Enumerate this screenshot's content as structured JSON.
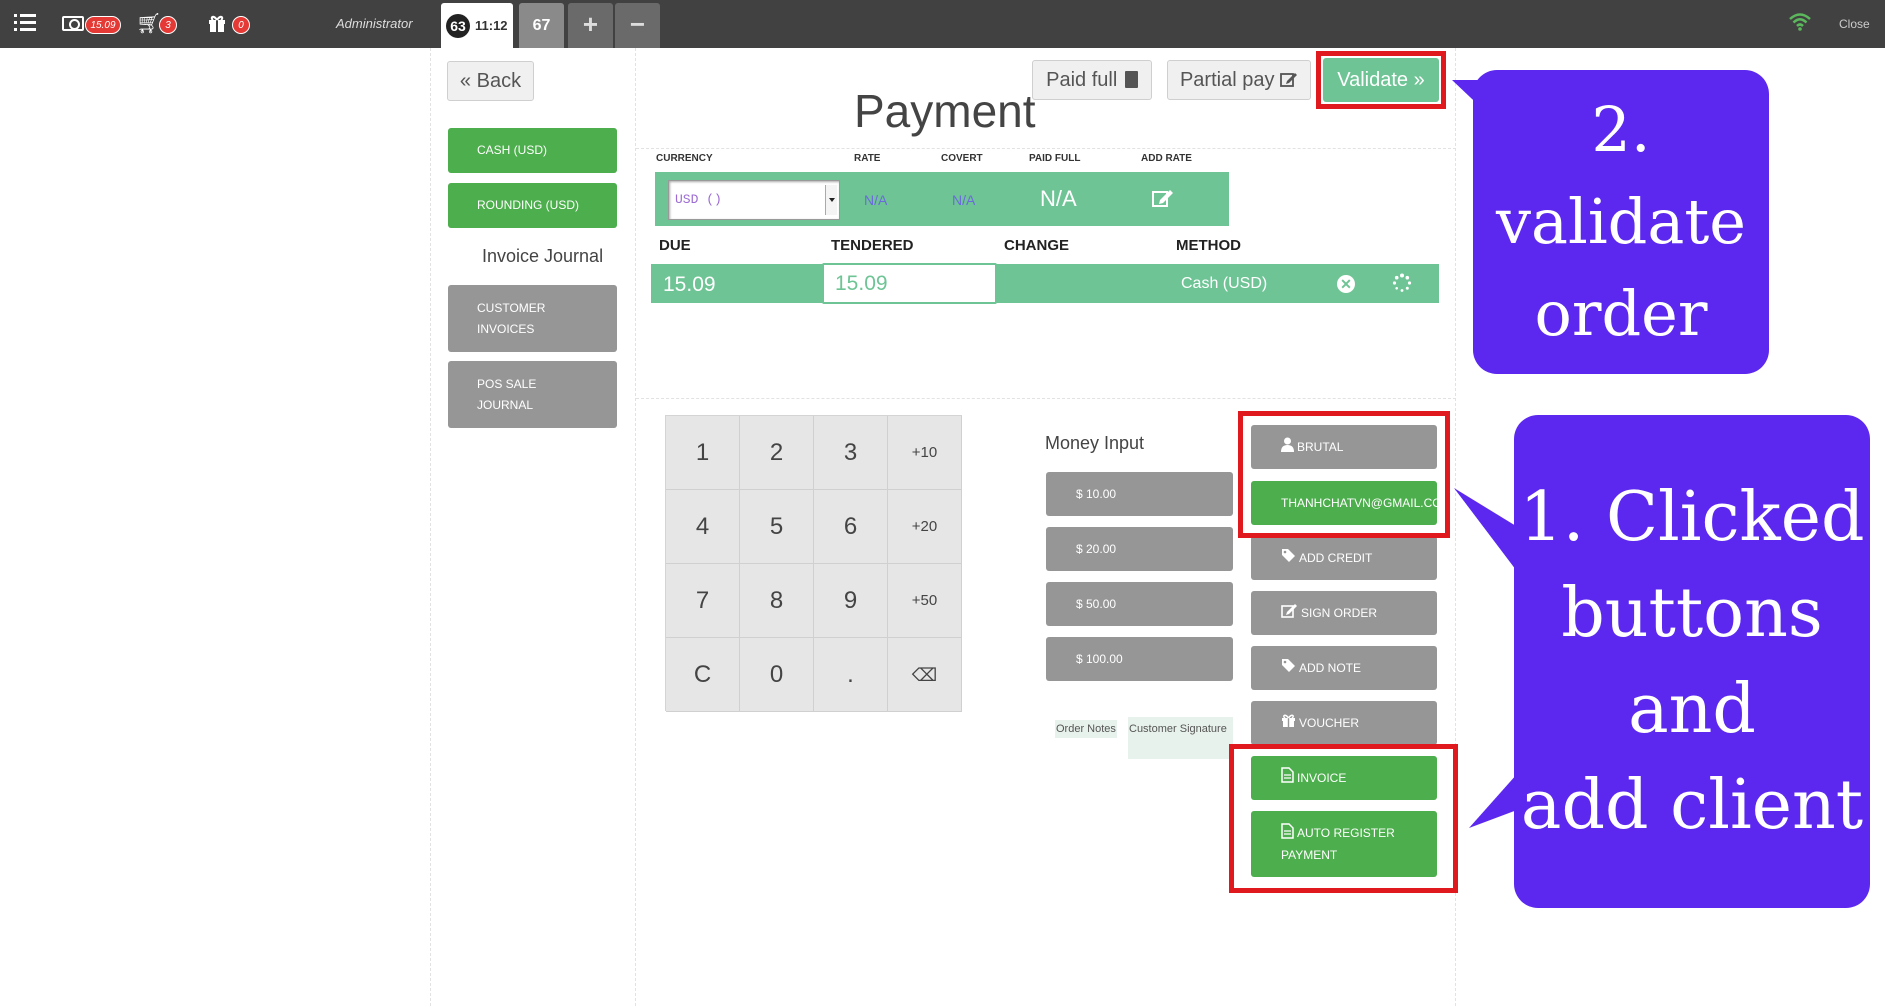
{
  "topbar": {
    "cash_badge": "15.09",
    "cart_badge": "3",
    "gift_badge": "0",
    "user": "Administrator",
    "active_order_number": "63",
    "active_order_time": "11:12",
    "other_order": "67",
    "add_order": "+",
    "remove_order": "−",
    "close_label": "Close"
  },
  "header": {
    "back_label": "« Back",
    "title": "Payment",
    "paid_full_label": "Paid full",
    "partial_pay_label": "Partial pay",
    "validate_label": "Validate »"
  },
  "sidebar": {
    "methods": [
      {
        "label": "CASH (USD)"
      },
      {
        "label": "ROUNDING (USD)"
      }
    ],
    "journal_title": "Invoice Journal",
    "journals": [
      {
        "label": "CUSTOMER INVOICES"
      },
      {
        "label": "POS SALE JOURNAL"
      }
    ]
  },
  "currency": {
    "headers": {
      "currency": "CURRENCY",
      "rate": "RATE",
      "covert": "COVERT",
      "paid_full": "PAID FULL",
      "add_rate": "ADD RATE"
    },
    "selected": "USD ()",
    "rate": "N/A",
    "covert": "N/A",
    "paid_full": "N/A"
  },
  "paymentlines": {
    "headers": {
      "due": "DUE",
      "tendered": "TENDERED",
      "change": "CHANGE",
      "method": "METHOD"
    },
    "line": {
      "due": "15.09",
      "tendered": "15.09",
      "change": "",
      "method": "Cash (USD)"
    }
  },
  "numpad": {
    "keys": [
      "1",
      "2",
      "3",
      "+10",
      "4",
      "5",
      "6",
      "+20",
      "7",
      "8",
      "9",
      "+50",
      "C",
      "0",
      ".",
      "⌫"
    ]
  },
  "money_input": {
    "title": "Money Input",
    "amounts": [
      "$ 10.00",
      "$ 20.00",
      "$ 50.00",
      "$ 100.00"
    ],
    "order_notes": "Order Notes",
    "customer_signature": "Customer Signature"
  },
  "actions": {
    "client": "BRUTAL",
    "email": "THANHCHATVN@GMAIL.COM",
    "add_credit": "ADD CREDIT",
    "sign_order": "SIGN ORDER",
    "add_note": "ADD NOTE",
    "voucher": "VOUCHER",
    "invoice": "INVOICE",
    "auto_register": "AUTO REGISTER PAYMENT"
  },
  "annotations": {
    "bubble1": [
      "1. Clicked",
      "buttons and",
      "add client"
    ],
    "bubble2": [
      "2.",
      "validate",
      "order"
    ]
  },
  "colors": {
    "topbar": "#414141",
    "green": "#4cae4c",
    "teal": "#6ec495",
    "gray_button": "#969696",
    "annotation_bubble": "#5c28f0",
    "annotation_box": "#e0191f"
  }
}
